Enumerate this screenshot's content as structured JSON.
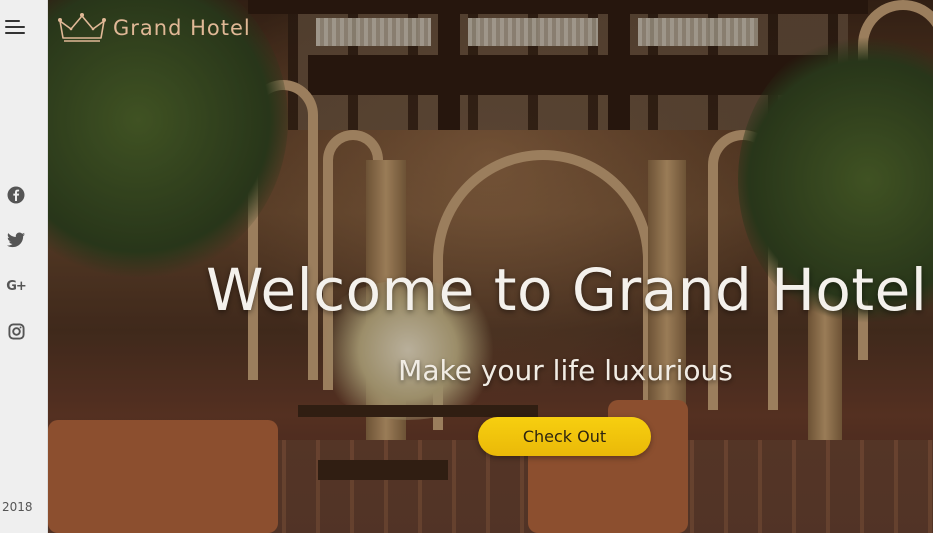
{
  "brand": {
    "name": "Grand Hotel",
    "logo_icon": "crown-icon",
    "accent_color": "#e0b896"
  },
  "sidebar": {
    "menu_icon": "hamburger-menu-icon",
    "social": [
      {
        "name": "facebook-icon"
      },
      {
        "name": "twitter-icon"
      },
      {
        "name": "google-plus-icon",
        "glyph": "G+"
      },
      {
        "name": "instagram-icon"
      }
    ],
    "year": "2018"
  },
  "hero": {
    "headline": "Welcome to Grand Hotel",
    "subline": "Make your life luxurious",
    "cta_label": "Check Out",
    "cta_color": "#f2c40c"
  }
}
